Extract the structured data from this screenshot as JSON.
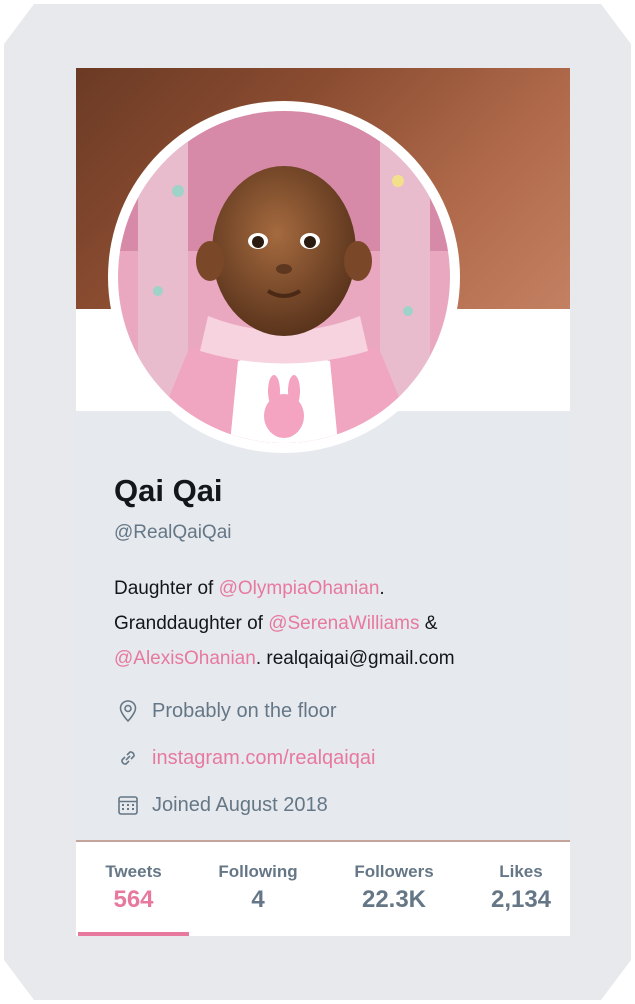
{
  "profile": {
    "name": "Qai Qai",
    "handle": "@RealQaiQai",
    "bio": {
      "line1_prefix": "Daughter of ",
      "line1_mention": "@OlympiaOhanian",
      "line1_suffix": ".",
      "line2_prefix": "Granddaughter of ",
      "line2_mention": "@SerenaWilliams",
      "line2_suffix": " &",
      "line3_mention": "@AlexisOhanian",
      "line3_suffix": ". realqaiqai@gmail.com"
    },
    "location": "Probably on the floor",
    "website": "instagram.com/realqaiqai",
    "joined": "Joined August 2018"
  },
  "stats": [
    {
      "label": "Tweets",
      "value": "564"
    },
    {
      "label": "Following",
      "value": "4"
    },
    {
      "label": "Followers",
      "value": "22.3K"
    },
    {
      "label": "Likes",
      "value": "2,134"
    }
  ],
  "icons": {
    "location": "map-pin-icon",
    "website": "link-icon",
    "joined": "calendar-icon"
  },
  "colors": {
    "accent": "#e8799e",
    "secondary_text": "#657786",
    "primary_text": "#14171a",
    "card_background": "#e6e9ed"
  }
}
